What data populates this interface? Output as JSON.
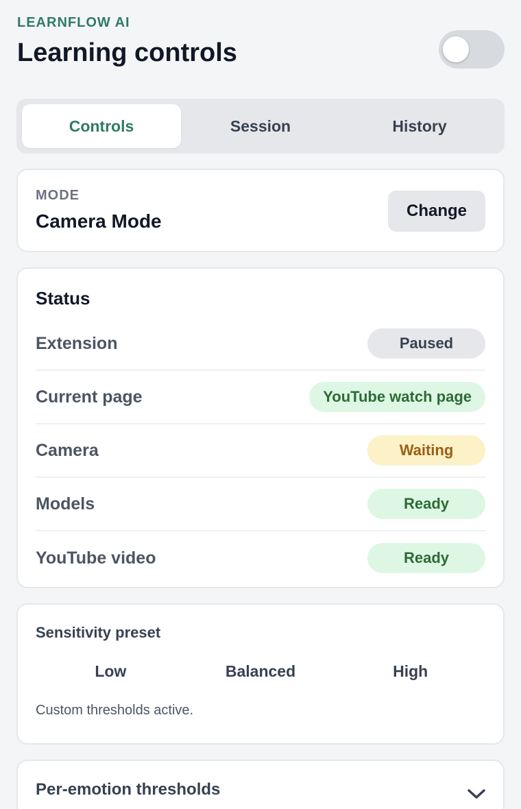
{
  "header": {
    "brand": "LEARNFLOW AI",
    "title": "Learning controls",
    "toggle_on": false
  },
  "tabs": [
    {
      "label": "Controls",
      "active": true
    },
    {
      "label": "Session",
      "active": false
    },
    {
      "label": "History",
      "active": false
    }
  ],
  "mode": {
    "label": "MODE",
    "value": "Camera Mode",
    "change_label": "Change"
  },
  "status": {
    "title": "Status",
    "rows": [
      {
        "name": "Extension",
        "value": "Paused",
        "bg": "#e6e7ea",
        "fg": "#374151"
      },
      {
        "name": "Current page",
        "value": "YouTube watch page",
        "bg": "#ddf7e4",
        "fg": "#2e6a37"
      },
      {
        "name": "Camera",
        "value": "Waiting",
        "bg": "#fcf1c7",
        "fg": "#9a6016"
      },
      {
        "name": "Models",
        "value": "Ready",
        "bg": "#ddf7e4",
        "fg": "#2e6a37"
      },
      {
        "name": "YouTube video",
        "value": "Ready",
        "bg": "#ddf7e4",
        "fg": "#2e6a37"
      }
    ]
  },
  "sensitivity": {
    "title": "Sensitivity preset",
    "options": [
      "Low",
      "Balanced",
      "High"
    ],
    "note": "Custom thresholds active."
  },
  "per_emotion": {
    "title": "Per-emotion thresholds",
    "icon": "chevron-down-icon"
  },
  "colors": {
    "accent": "#2f7a66",
    "background": "#f4f5f7"
  }
}
